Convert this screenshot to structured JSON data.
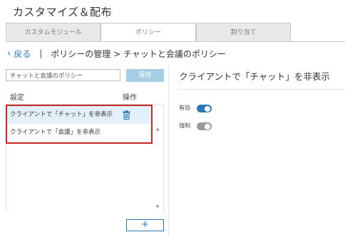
{
  "page": {
    "title": "カスタマイズ＆配布"
  },
  "tabs": [
    {
      "label": "カスタムモジュール"
    },
    {
      "label": "ポリシー"
    },
    {
      "label": "割り当て"
    }
  ],
  "breadcrumb": {
    "back_label": "戻る",
    "separator": "|",
    "path": "ポリシーの管理 > チャットと会議のポリシー"
  },
  "policy_name": {
    "value": "チャットと会議のポリシー",
    "save_label": "保存"
  },
  "settings_list": {
    "header_setting": "設定",
    "header_action": "操作",
    "items": [
      {
        "label": "クライアントで「チャット」を非表示",
        "selected": true,
        "icon": "trash-icon"
      },
      {
        "label": "クライアントで「会議」を非表示",
        "selected": false
      }
    ],
    "add_label": "+"
  },
  "detail": {
    "title": "クライアントで「チャット」を非表示",
    "options": [
      {
        "label": "有効",
        "on": true
      },
      {
        "label": "強制",
        "on": false
      }
    ]
  },
  "colors": {
    "accent": "#2a7ab7",
    "selected_row": "#e3f0f9",
    "highlight_border": "#c62828",
    "toggle_off": "#9a9a9a"
  }
}
